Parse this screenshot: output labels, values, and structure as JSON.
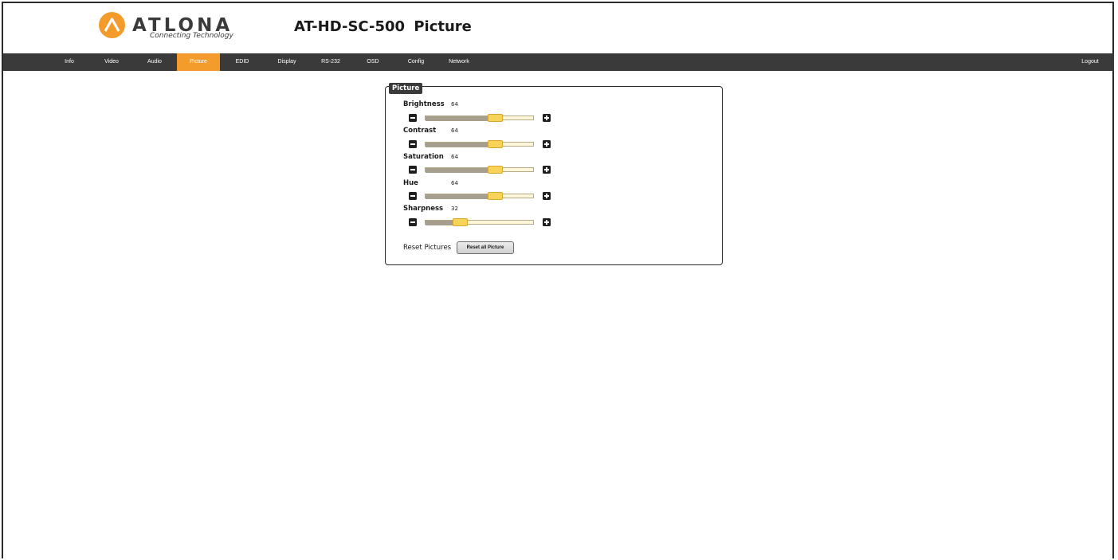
{
  "brand": {
    "name": "ATLONA",
    "tagline": "Connecting Technology",
    "accent_color": "#f39c2b"
  },
  "header": {
    "title": "AT-HD-SC-500  Picture"
  },
  "nav": {
    "items": [
      {
        "label": "Info"
      },
      {
        "label": "Video"
      },
      {
        "label": "Audio"
      },
      {
        "label": "Picture",
        "active": true
      },
      {
        "label": "EDID"
      },
      {
        "label": "Display"
      },
      {
        "label": "RS-232"
      },
      {
        "label": "OSD"
      },
      {
        "label": "Config"
      },
      {
        "label": "Network"
      }
    ],
    "logout_label": "Logout",
    "bar_color": "#3a3a3a"
  },
  "panel": {
    "title": "Picture",
    "controls": [
      {
        "label": "Brightness",
        "value": "64",
        "fraction": 0.64
      },
      {
        "label": "Contrast",
        "value": "64",
        "fraction": 0.64
      },
      {
        "label": "Saturation",
        "value": "64",
        "fraction": 0.64
      },
      {
        "label": "Hue",
        "value": "64",
        "fraction": 0.64
      },
      {
        "label": "Sharpness",
        "value": "32",
        "fraction": 0.32
      }
    ],
    "reset_label": "Reset Pictures",
    "reset_button_label": "Reset all Picture"
  }
}
